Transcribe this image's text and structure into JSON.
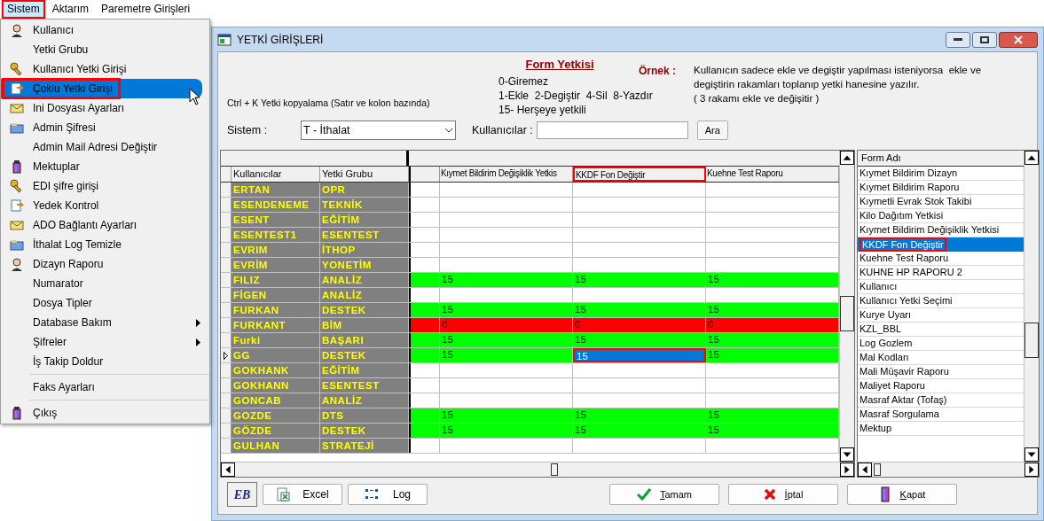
{
  "menubar": [
    {
      "label": "Sistem",
      "selected": true,
      "highlighted": true
    },
    {
      "label": "Aktarım",
      "selected": false,
      "highlighted": false
    },
    {
      "label": "Paremetre Girişleri",
      "selected": false,
      "highlighted": false
    }
  ],
  "dropdown": [
    [
      {
        "label": "Kullanıcı",
        "icon": true,
        "submenu": false,
        "selected": false,
        "highlighted": false
      },
      {
        "label": "Yetki Grubu",
        "icon": false,
        "submenu": false,
        "selected": false,
        "highlighted": false
      },
      {
        "label": "Kullanıcı Yetki Girişi",
        "icon": true,
        "submenu": false,
        "selected": false,
        "highlighted": false
      },
      {
        "label": "Çoklu Yetki Girişi",
        "icon": true,
        "submenu": false,
        "selected": true,
        "highlighted": true
      },
      {
        "label": "Ini Dosyası  Ayarları",
        "icon": true,
        "submenu": false,
        "selected": false,
        "highlighted": false
      },
      {
        "label": "Admin Şifresi",
        "icon": true,
        "submenu": false,
        "selected": false,
        "highlighted": false
      },
      {
        "label": "Admin Mail Adresi Değiştir",
        "icon": false,
        "submenu": false,
        "selected": false,
        "highlighted": false
      },
      {
        "label": "Mektuplar",
        "icon": true,
        "submenu": false,
        "selected": false,
        "highlighted": false
      },
      {
        "label": "EDI şifre girişi",
        "icon": true,
        "submenu": false,
        "selected": false,
        "highlighted": false
      },
      {
        "label": "Yedek Kontrol",
        "icon": true,
        "submenu": false,
        "selected": false,
        "highlighted": false
      },
      {
        "label": "ADO Bağlantı Ayarları",
        "icon": true,
        "submenu": false,
        "selected": false,
        "highlighted": false
      },
      {
        "label": "İthalat Log Temizle",
        "icon": true,
        "submenu": false,
        "selected": false,
        "highlighted": false
      },
      {
        "label": "Dizayn Raporu",
        "icon": true,
        "submenu": false,
        "selected": false,
        "highlighted": false
      },
      {
        "label": "Numarator",
        "icon": false,
        "submenu": false,
        "selected": false,
        "highlighted": false
      },
      {
        "label": "Dosya Tipler",
        "icon": false,
        "submenu": false,
        "selected": false,
        "highlighted": false
      },
      {
        "label": "Database Bakım",
        "icon": false,
        "submenu": true,
        "selected": false,
        "highlighted": false
      },
      {
        "label": "Şifreler",
        "icon": false,
        "submenu": true,
        "selected": false,
        "highlighted": false
      },
      {
        "label": "İş Takip Doldur",
        "icon": false,
        "submenu": false,
        "selected": false,
        "highlighted": false
      }
    ],
    [
      {
        "label": "Faks Ayarları",
        "icon": false,
        "submenu": false,
        "selected": false,
        "highlighted": false
      }
    ],
    [
      {
        "label": "Çıkış",
        "icon": true,
        "submenu": false,
        "selected": false,
        "highlighted": false
      }
    ]
  ],
  "window": {
    "title": "YETKİ GİRİŞLERİ"
  },
  "header": {
    "ctrl_hint": "Ctrl + K Yetki kopyalama (Satır ve kolon bazında)",
    "legend_title": "Form Yetkisi",
    "legend_lines": [
      "0-Giremez",
      "1-Ekle  2-Degiştir  4-Sil  8-Yazdır",
      "15- Herşeye yetkili"
    ],
    "example_label": "Örnek :",
    "example_lines": [
      "Kullanıcın sadece ekle ve degiştir yapılması isteniyorsa  ekle ve",
      "degiştirin rakamları toplanıp yetki hanesine yazılır.",
      "( 3 rakamı ekle ve değişitir )"
    ]
  },
  "filters": {
    "sistem_label": "Sistem :",
    "sistem_value": "T - İthalat",
    "users_label": "Kullanıcılar :",
    "search_button": "Ara"
  },
  "grid": {
    "frozen_columns": [
      "Kullanıcılar",
      "Yetki Grubu"
    ],
    "columns": [
      {
        "label": "Kıymet Bildirim Değişiklik Yetkis",
        "highlighted": false
      },
      {
        "label": "KKDF Fon Değiştir",
        "highlighted": true
      },
      {
        "label": "Kuehne Test Raporu",
        "highlighted": false
      }
    ],
    "rows": [
      {
        "user": "ERTAN",
        "group": "OPR",
        "current": false,
        "cells": []
      },
      {
        "user": "ESENDENEME",
        "group": "TEKNİK",
        "current": false,
        "cells": []
      },
      {
        "user": "ESENT",
        "group": "EĞİTİM",
        "current": false,
        "cells": []
      },
      {
        "user": "ESENTEST1",
        "group": "ESENTEST",
        "current": false,
        "cells": []
      },
      {
        "user": "EVRIM",
        "group": "İTHOP",
        "current": false,
        "cells": []
      },
      {
        "user": "EVRİM",
        "group": "YONETİM",
        "current": false,
        "cells": []
      },
      {
        "user": "FILIZ",
        "group": "ANALİZ",
        "current": false,
        "color": "#00ff00",
        "cells": [
          {
            "value": "15",
            "selected": false,
            "highlighted": false
          },
          {
            "value": "15",
            "selected": false,
            "highlighted": false
          },
          {
            "value": "15",
            "selected": false,
            "highlighted": false
          }
        ]
      },
      {
        "user": "FİGEN",
        "group": "ANALİZ",
        "current": false,
        "cells": []
      },
      {
        "user": "FURKAN",
        "group": "DESTEK",
        "current": false,
        "color": "#00ff00",
        "cells": [
          {
            "value": "15",
            "selected": false,
            "highlighted": false
          },
          {
            "value": "15",
            "selected": false,
            "highlighted": false
          },
          {
            "value": "15",
            "selected": false,
            "highlighted": false
          }
        ]
      },
      {
        "user": "FURKANT",
        "group": "BİM",
        "current": false,
        "color": "#ff0000",
        "cells": [
          {
            "value": "0",
            "selected": false,
            "highlighted": false
          },
          {
            "value": "0",
            "selected": false,
            "highlighted": false
          },
          {
            "value": "0",
            "selected": false,
            "highlighted": false
          }
        ]
      },
      {
        "user": "Furki",
        "group": "BAŞARI",
        "current": false,
        "color": "#00ff00",
        "cells": [
          {
            "value": "15",
            "selected": false,
            "highlighted": false
          },
          {
            "value": "15",
            "selected": false,
            "highlighted": false
          },
          {
            "value": "15",
            "selected": false,
            "highlighted": false
          }
        ]
      },
      {
        "user": "GG",
        "group": "DESTEK",
        "current": true,
        "color": "#00ff00",
        "cells": [
          {
            "value": "15",
            "selected": false,
            "highlighted": false
          },
          {
            "value": "15",
            "selected": true,
            "highlighted": true
          },
          {
            "value": "15",
            "selected": false,
            "highlighted": false
          }
        ]
      },
      {
        "user": "GOKHANK",
        "group": "EĞİTİM",
        "current": false,
        "cells": []
      },
      {
        "user": "GOKHANN",
        "group": "ESENTEST",
        "current": false,
        "cells": []
      },
      {
        "user": "GONCAB",
        "group": "ANALİZ",
        "current": false,
        "cells": []
      },
      {
        "user": "GOZDE",
        "group": "DTS",
        "current": false,
        "color": "#00ff00",
        "cells": [
          {
            "value": "15",
            "selected": false,
            "highlighted": false
          },
          {
            "value": "15",
            "selected": false,
            "highlighted": false
          },
          {
            "value": "15",
            "selected": false,
            "highlighted": false
          }
        ]
      },
      {
        "user": "GÖZDE",
        "group": "DESTEK",
        "current": false,
        "color": "#00ff00",
        "cells": [
          {
            "value": "15",
            "selected": false,
            "highlighted": false
          },
          {
            "value": "15",
            "selected": false,
            "highlighted": false
          },
          {
            "value": "15",
            "selected": false,
            "highlighted": false
          }
        ]
      },
      {
        "user": "GULHAN",
        "group": "STRATEJİ",
        "current": false,
        "cells": []
      }
    ]
  },
  "form_list": {
    "header": "Form Adı",
    "items": [
      {
        "label": "Kıymet Bildirim Dizayn",
        "selected": false,
        "highlighted": false
      },
      {
        "label": "Kıymet Bildirim Raporu",
        "selected": false,
        "highlighted": false
      },
      {
        "label": "Kıymetli Evrak Stok Takibi",
        "selected": false,
        "highlighted": false
      },
      {
        "label": "Kilo Dağıtım Yetkisi",
        "selected": false,
        "highlighted": false
      },
      {
        "label": "Kıymet Bildirim Değişiklik Yetkisi",
        "selected": false,
        "highlighted": false
      },
      {
        "label": "KKDF Fon Değiştir",
        "selected": true,
        "highlighted": true
      },
      {
        "label": "Kuehne Test Raporu",
        "selected": false,
        "highlighted": false
      },
      {
        "label": "KUHNE HP RAPORU 2",
        "selected": false,
        "highlighted": false
      },
      {
        "label": "Kullanıcı",
        "selected": false,
        "highlighted": false
      },
      {
        "label": "Kullanıcı Yetki Seçimi",
        "selected": false,
        "highlighted": false
      },
      {
        "label": "Kurye Uyarı",
        "selected": false,
        "highlighted": false
      },
      {
        "label": "KZL_BBL",
        "selected": false,
        "highlighted": false
      },
      {
        "label": "Log Gozlem",
        "selected": false,
        "highlighted": false
      },
      {
        "label": "Mal Kodları",
        "selected": false,
        "highlighted": false
      },
      {
        "label": "Mali Müşavir Raporu",
        "selected": false,
        "highlighted": false
      },
      {
        "label": "Maliyet Raporu",
        "selected": false,
        "highlighted": false
      },
      {
        "label": "Masraf Aktar (Tofaş)",
        "selected": false,
        "highlighted": false
      },
      {
        "label": "Masraf Sorgulama",
        "selected": false,
        "highlighted": false
      },
      {
        "label": "Mektup",
        "selected": false,
        "highlighted": false
      }
    ]
  },
  "toolbar": {
    "logo_text": "EB",
    "buttons": [
      {
        "label": "Excel",
        "kind": "excel"
      },
      {
        "label": "Log",
        "kind": "log"
      }
    ]
  },
  "actions": [
    {
      "label": "Tamam",
      "kind": "ok"
    },
    {
      "label": "İptal",
      "kind": "cancel"
    },
    {
      "label": "Kapat",
      "kind": "close"
    }
  ]
}
